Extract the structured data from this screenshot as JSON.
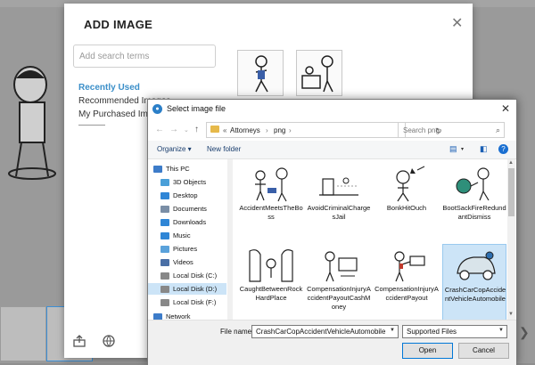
{
  "modal": {
    "title": "ADD IMAGE",
    "close": "✕",
    "search_placeholder": "Add search terms",
    "nav": [
      {
        "label": "Recently Used",
        "active": true
      },
      {
        "label": "Recommended Images",
        "active": false
      },
      {
        "label": "My Purchased Images",
        "active": false
      }
    ],
    "footer_icons": [
      "upload-icon",
      "globe-icon"
    ]
  },
  "dialog": {
    "title": "Select image file",
    "close": "✕",
    "breadcrumb": [
      "«",
      "Attorneys",
      "›",
      "png",
      "›"
    ],
    "refresh": "↻",
    "search_placeholder": "Search png",
    "organize": "Organize ▾",
    "new_folder": "New folder",
    "help": "?",
    "tree": [
      {
        "label": "This PC",
        "icon": "pc-icon",
        "color": "#3d7cc9"
      },
      {
        "label": "3D Objects",
        "icon": "cube-icon",
        "color": "#4a9fd8"
      },
      {
        "label": "Desktop",
        "icon": "desktop-icon",
        "color": "#2f86d6"
      },
      {
        "label": "Documents",
        "icon": "documents-icon",
        "color": "#7a8ea6"
      },
      {
        "label": "Downloads",
        "icon": "downloads-icon",
        "color": "#2f86d6"
      },
      {
        "label": "Music",
        "icon": "music-icon",
        "color": "#2f86d6"
      },
      {
        "label": "Pictures",
        "icon": "pictures-icon",
        "color": "#5aa2db"
      },
      {
        "label": "Videos",
        "icon": "videos-icon",
        "color": "#4a6fa5"
      },
      {
        "label": "Local Disk (C:)",
        "icon": "disk-icon",
        "color": "#888888"
      },
      {
        "label": "Local Disk (D:)",
        "icon": "disk-icon",
        "color": "#888888",
        "selected": true
      },
      {
        "label": "Local Disk (F:)",
        "icon": "disk-icon",
        "color": "#888888"
      },
      {
        "label": "Network",
        "icon": "network-icon",
        "color": "#3d7cc9"
      }
    ],
    "files": [
      {
        "name": "AccidentMeetsTheBoss"
      },
      {
        "name": "AvoidCriminalChargesJail"
      },
      {
        "name": "BonkHitOuch"
      },
      {
        "name": "BootSackFireRedundantDismiss"
      },
      {
        "name": "CaughtBetweenRockHardPlace"
      },
      {
        "name": "CompensationInjuryAccidentPayoutCashMoney"
      },
      {
        "name": "CompensationInjuryAccidentPayout"
      },
      {
        "name": "CrashCarCopAccidentVehicleAutomobile",
        "selected": true
      }
    ],
    "file_name_label": "File name:",
    "file_name_value": "CrashCarCopAccidentVehicleAutomobile",
    "file_type": "Supported Files",
    "open": "Open",
    "cancel": "Cancel"
  },
  "accent": "#3b8fc9"
}
